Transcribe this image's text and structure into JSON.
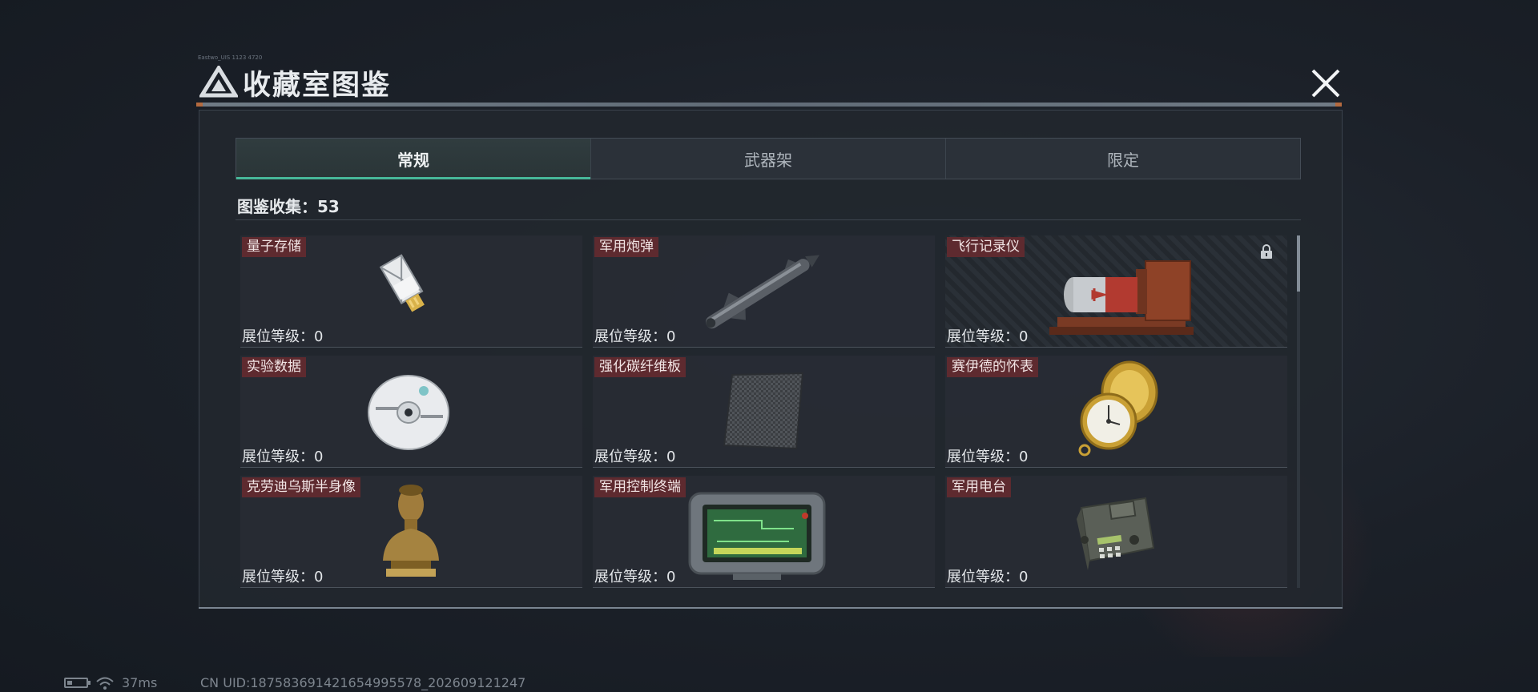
{
  "window": {
    "title": "收藏室图鉴",
    "tiny_label": "Eastwo_UIS 1123 4720"
  },
  "tabs": [
    {
      "label": "常规",
      "active": true
    },
    {
      "label": "武器架",
      "active": false
    },
    {
      "label": "限定",
      "active": false
    }
  ],
  "collection": {
    "label": "图鉴收集：53"
  },
  "items": [
    {
      "name": "量子存储",
      "level_text": "展位等级：0",
      "icon": "usb-drive-icon",
      "locked": false
    },
    {
      "name": "军用炮弹",
      "level_text": "展位等级：0",
      "icon": "missile-icon",
      "locked": false
    },
    {
      "name": "飞行记录仪",
      "level_text": "展位等级：0",
      "icon": "flight-recorder-icon",
      "locked": true
    },
    {
      "name": "实验数据",
      "level_text": "展位等级：0",
      "icon": "disc-icon",
      "locked": false
    },
    {
      "name": "强化碳纤维板",
      "level_text": "展位等级：0",
      "icon": "carbon-plate-icon",
      "locked": false
    },
    {
      "name": "赛伊德的怀表",
      "level_text": "展位等级：0",
      "icon": "pocket-watch-icon",
      "locked": false
    },
    {
      "name": "克劳迪乌斯半身像",
      "level_text": "展位等级：0",
      "icon": "bust-icon",
      "locked": false
    },
    {
      "name": "军用控制终端",
      "level_text": "展位等级：0",
      "icon": "control-terminal-icon",
      "locked": false
    },
    {
      "name": "军用电台",
      "level_text": "展位等级：0",
      "icon": "radio-icon",
      "locked": false
    }
  ],
  "status_bar": {
    "ping": "37ms",
    "uid": "CN UID:187583691421654995578_202609121247"
  },
  "colors": {
    "accent": "#47b899",
    "name_tag": "#5e2a2f",
    "background": "#1b2028"
  }
}
